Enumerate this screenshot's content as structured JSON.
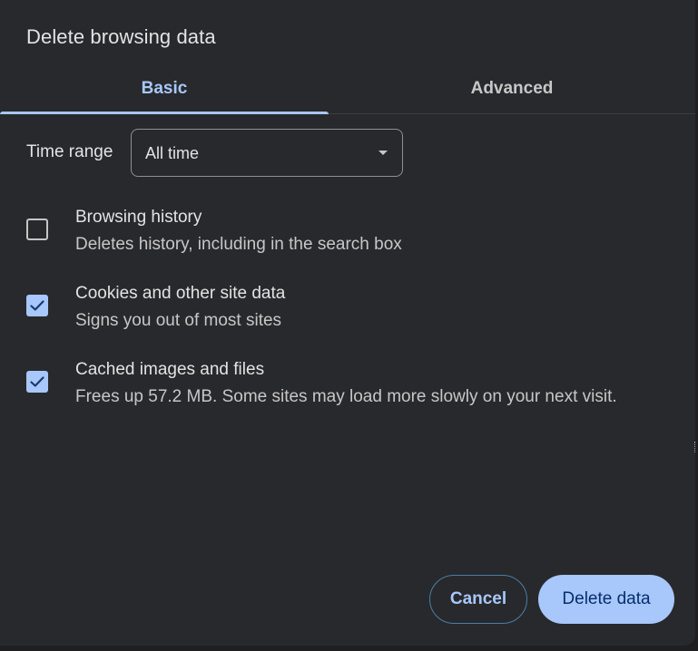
{
  "dialog": {
    "title": "Delete browsing data"
  },
  "tabs": [
    {
      "label": "Basic",
      "selected": true
    },
    {
      "label": "Advanced",
      "selected": false
    }
  ],
  "time_range": {
    "label": "Time range",
    "value": "All time"
  },
  "options": [
    {
      "title": "Browsing history",
      "description": "Deletes history, including in the search box",
      "checked": false
    },
    {
      "title": "Cookies and other site data",
      "description": "Signs you out of most sites",
      "checked": true
    },
    {
      "title": "Cached images and files",
      "description": "Frees up 57.2 MB. Some sites may load more slowly on your next visit.",
      "checked": true
    }
  ],
  "buttons": {
    "cancel": "Cancel",
    "delete": "Delete data"
  },
  "colors": {
    "accent": "#a8c7fa",
    "background": "#28292c",
    "primary_text": "#e3e3e3",
    "button_text_dark": "#062e6f"
  },
  "icons": {
    "checkmark": "check-icon",
    "dropdown": "chevron-down-icon"
  }
}
